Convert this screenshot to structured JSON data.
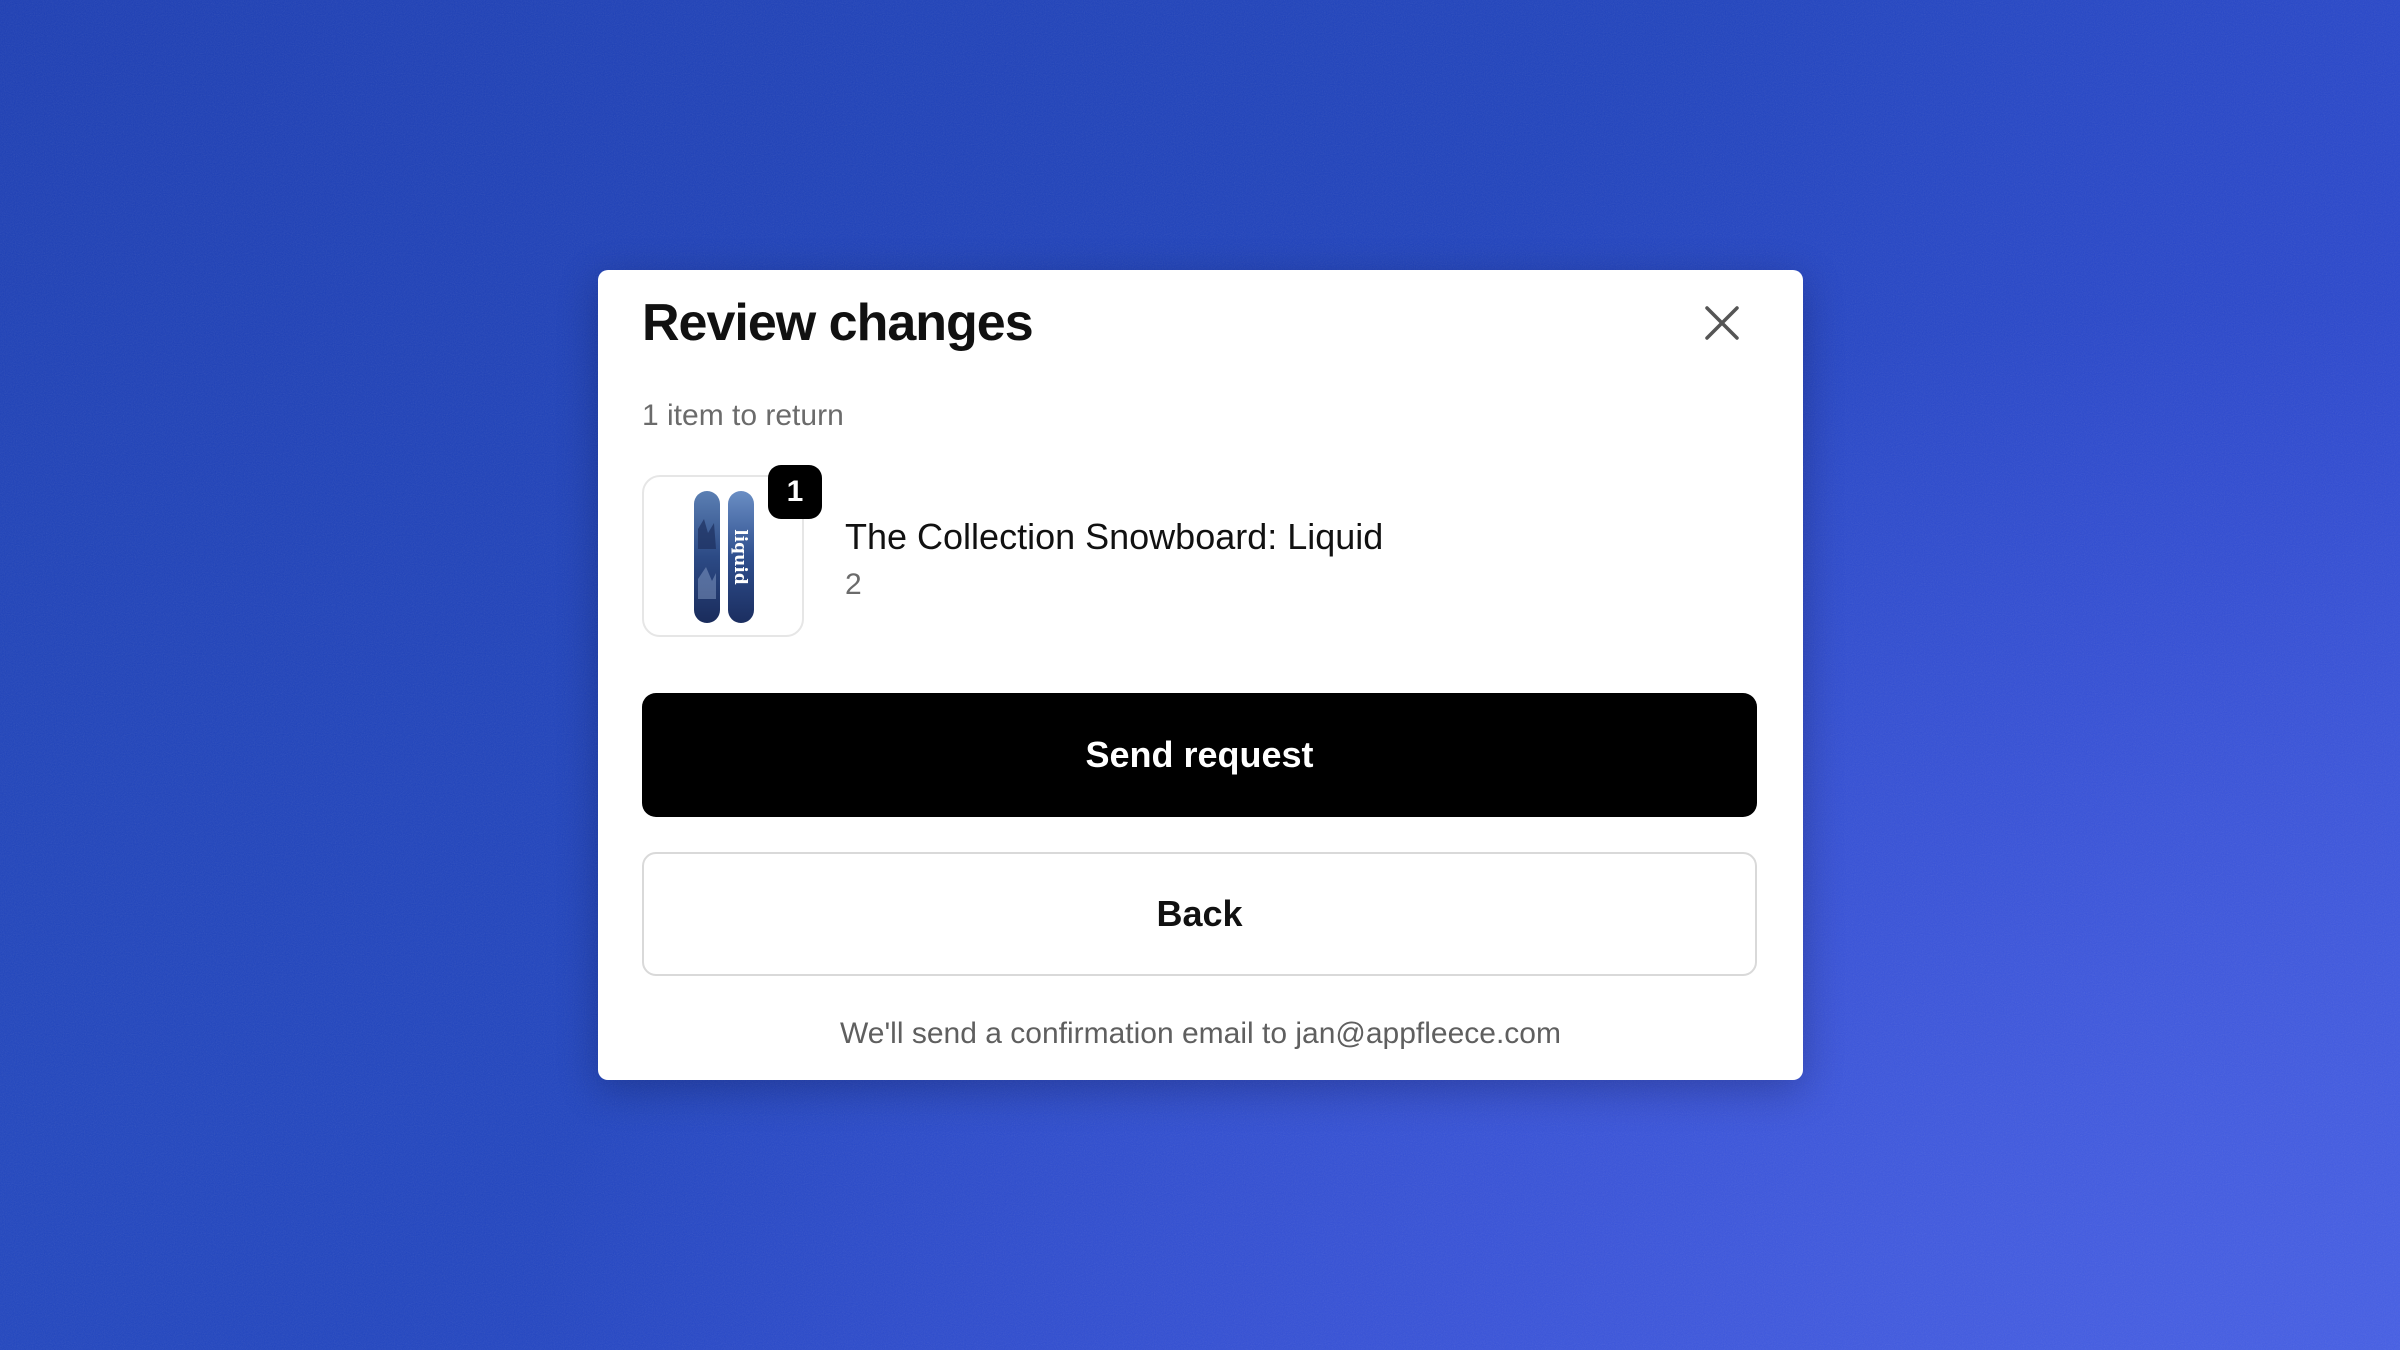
{
  "colors": {
    "background_accent": "#2145c0",
    "modal_bg": "#ffffff",
    "primary_button_bg": "#000000",
    "primary_button_text": "#ffffff"
  },
  "modal": {
    "title": "Review changes",
    "close_icon": "close-icon",
    "subtitle": "1 item to return",
    "items": [
      {
        "image_icon": "snowboard-image",
        "image_logo_text": "liquid",
        "quantity_badge": "1",
        "name": "The Collection Snowboard: Liquid",
        "variant": "2"
      }
    ],
    "send_button_label": "Send request",
    "back_button_label": "Back",
    "footer_note": "We'll send a confirmation email to jan@appfleece.com"
  }
}
